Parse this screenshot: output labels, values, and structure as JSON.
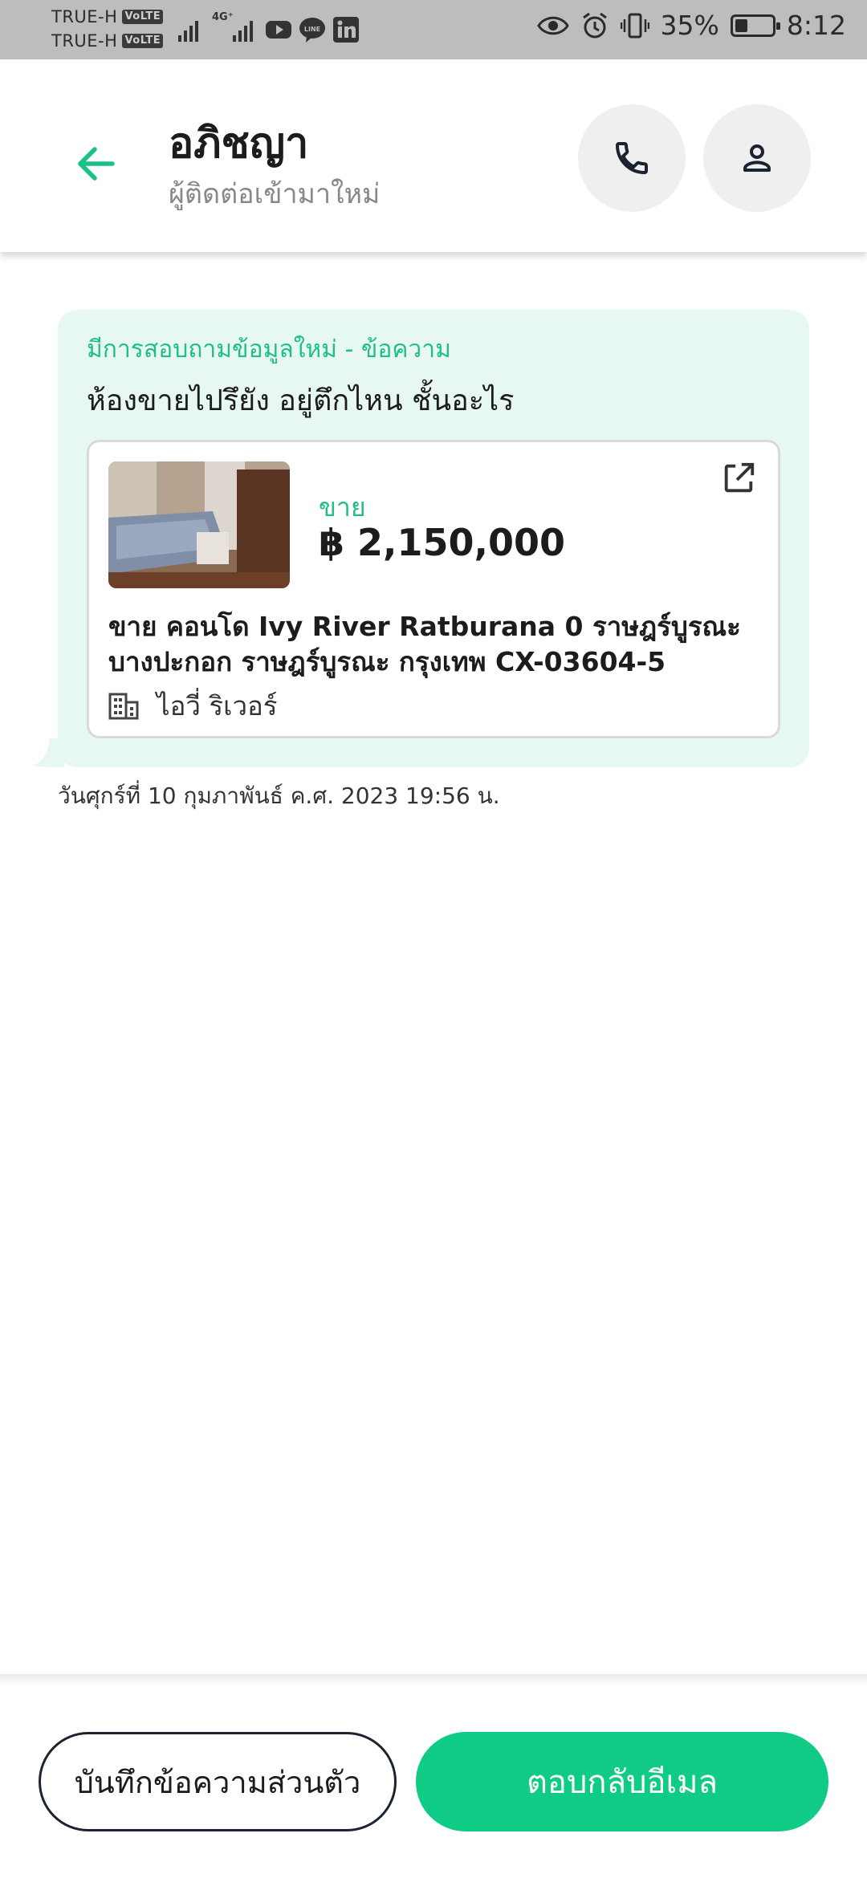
{
  "status_bar": {
    "carrier_1": "TRUE-H",
    "carrier_2": "TRUE-H",
    "volte_label": "VoLTE",
    "network_label": "4G⁺",
    "battery_percent": "35%",
    "battery_level": 0.35,
    "time": "8:12",
    "icons": [
      "signal-icon",
      "youtube-icon",
      "line-icon",
      "linkedin-icon",
      "eye-icon",
      "alarm-icon",
      "vibrate-icon",
      "battery-icon"
    ]
  },
  "header": {
    "contact_name": "อภิชญา",
    "subtitle": "ผู้ติดต่อเข้ามาใหม่",
    "icons": [
      "back-arrow-icon",
      "phone-icon",
      "person-icon"
    ]
  },
  "message": {
    "label": "มีการสอบถามข้อมูลใหม่ - ข้อความ",
    "text": "ห้องขายไปรึยัง อยู่ตึกไหน ชั้นอะไร",
    "listing": {
      "type": "ขาย",
      "price": "฿ 2,150,000",
      "title": "ขาย คอนโด  Ivy River Ratburana 0 ราษฎร์บูรณะ บางปะกอก ราษฎร์บูรณะ กรุงเทพ CX-03604-5",
      "project": "ไอวี่ ริเวอร์",
      "icons": [
        "open-external-icon",
        "building-icon"
      ]
    },
    "timestamp": "วันศุกร์ที่ 10 กุมภาพันธ์ ค.ศ. 2023 19:56 น."
  },
  "actions": {
    "private_note_label": "บันทึกข้อความส่วนตัว",
    "reply_email_label": "ตอบกลับอีเมล"
  },
  "colors": {
    "accent": "#0fcb86",
    "accent_text": "#1fbf85",
    "bubble_bg": "#e7f7f1",
    "status_bar_bg": "#bdbdbd"
  }
}
